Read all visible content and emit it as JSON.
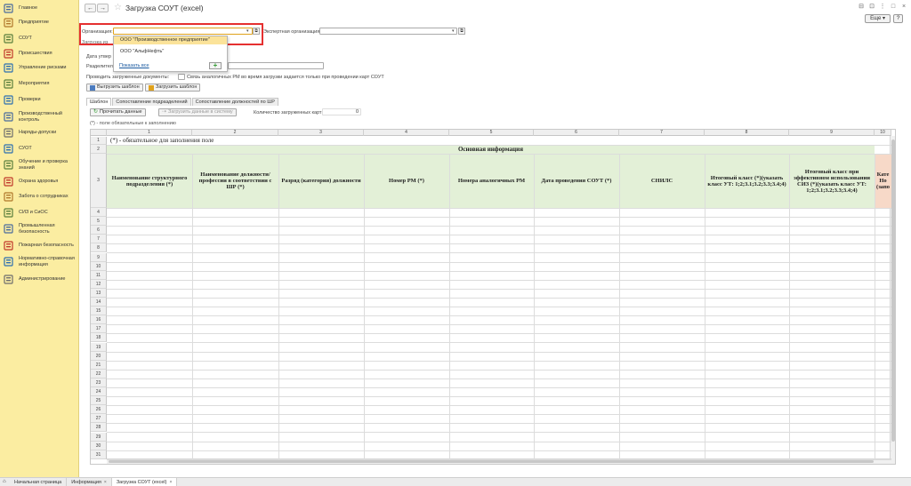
{
  "sidebar": {
    "items": [
      {
        "label": "Главное",
        "icon": "menu-icon"
      },
      {
        "label": "Предприятие",
        "icon": "building-icon"
      },
      {
        "label": "СОУТ",
        "icon": "clipboard-icon"
      },
      {
        "label": "Происшествия",
        "icon": "warning-icon"
      },
      {
        "label": "Управление рисками",
        "icon": "risk-chart-icon"
      },
      {
        "label": "Мероприятия",
        "icon": "calendar-icon"
      },
      {
        "label": "Проверки",
        "icon": "checklist-icon"
      },
      {
        "label": "Производственный контроль",
        "icon": "monitor-icon"
      },
      {
        "label": "Наряды-допуски",
        "icon": "permit-icon"
      },
      {
        "label": "СУОТ",
        "icon": "system-icon"
      },
      {
        "label": "Обучение и проверка знаний",
        "icon": "graduation-icon"
      },
      {
        "label": "Охрана здоровья",
        "icon": "medical-icon"
      },
      {
        "label": "Забота о сотрудниках",
        "icon": "care-icon"
      },
      {
        "label": "СИЗ и СиОС",
        "icon": "ppe-icon"
      },
      {
        "label": "Промышленная безопасность",
        "icon": "factory-icon"
      },
      {
        "label": "Пожарная безопасность",
        "icon": "fire-icon"
      },
      {
        "label": "Нормативно-справочная информация",
        "icon": "book-icon"
      },
      {
        "label": "Администрирование",
        "icon": "gear-icon"
      }
    ]
  },
  "header": {
    "back": "←",
    "forward": "→",
    "star": "☆",
    "title": "Загрузка СОУТ (excel)",
    "more": "Еще ▾",
    "help": "?"
  },
  "form": {
    "org_label": "Организация:",
    "org_value": "",
    "expert_label": "Экспертная организация:",
    "expert_value": "",
    "load_label": "Загрузка из",
    "date_label": "Дата утвер",
    "sep_label": "Разделитель",
    "process_label": "Проводить загруженные документы:",
    "link_label": "Связь аналогичных РМ во время загрузки задается только при проведении карт СОУТ",
    "unload_btn": "Выгрузить шаблон",
    "upload_btn": "Загрузить шаблон"
  },
  "dropdown": {
    "items": [
      "ООО \"Производственное предприятие\"",
      "ООО \"АльфНефть\""
    ],
    "show_all": "Показать все",
    "add": "+"
  },
  "tabs": [
    "Шаблон",
    "Сопоставление подразделений",
    "Сопоставление должностей по ШР"
  ],
  "actions": {
    "read_btn": "Прочитать данные",
    "load_btn": "Загрузить данные в систему",
    "count_label": "Количество загруженных карт:",
    "count_value": "0",
    "note": "(*) - поле обязательные к заполнению"
  },
  "sheet": {
    "columns": [
      "1",
      "2",
      "3",
      "4",
      "5",
      "6",
      "7",
      "8",
      "9",
      "10"
    ],
    "row1_text": "(*) - обязательное для заполнения поле",
    "row2_text": "Основная информация",
    "headers": [
      "Наименование структурного подразделения (*)",
      "Наименование должности/профессии в соответствии с ШР (*)",
      "Разряд (категория) должности",
      "Номер РМ (*)",
      "Номера аналогичных РМ",
      "Дата проведения СОУТ (*)",
      "СНИЛС",
      "Итоговый класс (*)(указать класс УТ: 1;2;3.1;3.2;3.3;3.4;4)",
      "Итоговый класс при эффективном использовании СИЗ (*)(указать класс УТ: 1;2;3.1;3.2;3.3;3.4;4)",
      "Кате Но (запо"
    ],
    "row_numbers": [
      "1",
      "2",
      "3",
      "4",
      "5",
      "6",
      "7",
      "8",
      "9",
      "10",
      "11",
      "12",
      "13",
      "14",
      "15",
      "16",
      "17",
      "18",
      "19",
      "20",
      "21",
      "22",
      "23",
      "24",
      "25",
      "26",
      "27",
      "28",
      "29",
      "30",
      "31"
    ]
  },
  "bottom_tabs": [
    {
      "label": "Начальная страница"
    },
    {
      "label": "Информация",
      "close": "×"
    },
    {
      "label": "Загрузка СОУТ (excel)",
      "close": "×"
    }
  ],
  "colors": {
    "sidebar_bg": "#fbeda1",
    "highlight": "#e53030",
    "header_green": "#e3f0d7",
    "selected_item": "#fbe39a"
  }
}
